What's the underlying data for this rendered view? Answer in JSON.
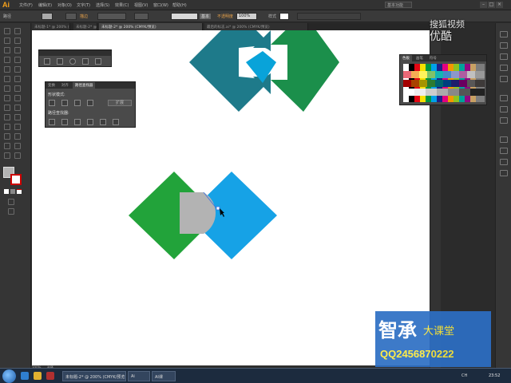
{
  "app": {
    "logo": "Ai"
  },
  "menubar": {
    "items": [
      "文件(F)",
      "编辑(E)",
      "对象(O)",
      "文字(T)",
      "选择(S)",
      "效果(C)",
      "视图(V)",
      "窗口(W)",
      "帮助(H)"
    ],
    "workspace": "基本功能"
  },
  "control": {
    "label_path": "路径",
    "stroke_label": "描边",
    "profile_label": "基本",
    "opacity_label": "不透明度",
    "opacity_value": "100%",
    "style_label": "样式"
  },
  "tabs": [
    "未标题-1* @ 200% (CMYK/预览)",
    "未标题-2* @ 200% (CMYK/预览)",
    "未标题-2* @ 200% (CMYK/预览)",
    "最后的标志.ai* @ 200% (CMYK/预览)"
  ],
  "pathfinder_panel": {
    "tabs": [
      "变换",
      "对齐",
      "路径查找器"
    ],
    "shape_modes_label": "形状模式:",
    "expand_label": "扩展",
    "pathfinders_label": "路径查找器:"
  },
  "swatches_panel": {
    "tabs": [
      "色板",
      "画笔",
      "符号"
    ]
  },
  "brand": {
    "name": "智承",
    "sub": "大课堂",
    "qq": "QQ2456870222"
  },
  "site_logo": {
    "line1": "搜狐视频",
    "line2": "优酷"
  },
  "status": {
    "zoom": "200%",
    "mode": "选择"
  },
  "taskbar": {
    "items": [
      "未标题-2* @ 200% (CMYK/预览)",
      "Ai",
      "AI课"
    ],
    "lang": "CH",
    "time": "23:52"
  },
  "colors": {
    "teal": "#1e7a8a",
    "green_dark": "#1b8f4b",
    "cyan": "#09a3d9",
    "green": "#22a33a",
    "blue": "#16a2e6",
    "gray": "#b3b3b3"
  },
  "icons": [
    "selection-tool-icon",
    "direct-selection-icon",
    "pen-icon",
    "type-icon",
    "line-icon",
    "rectangle-icon",
    "brush-icon",
    "pencil-icon",
    "eraser-icon",
    "rotate-icon",
    "scale-icon",
    "warp-icon",
    "free-transform-icon",
    "shape-builder-icon",
    "mesh-icon",
    "gradient-icon",
    "eyedropper-icon",
    "blend-icon",
    "symbol-sprayer-icon",
    "graph-icon",
    "artboard-icon",
    "slice-icon",
    "hand-icon",
    "zoom-icon"
  ]
}
